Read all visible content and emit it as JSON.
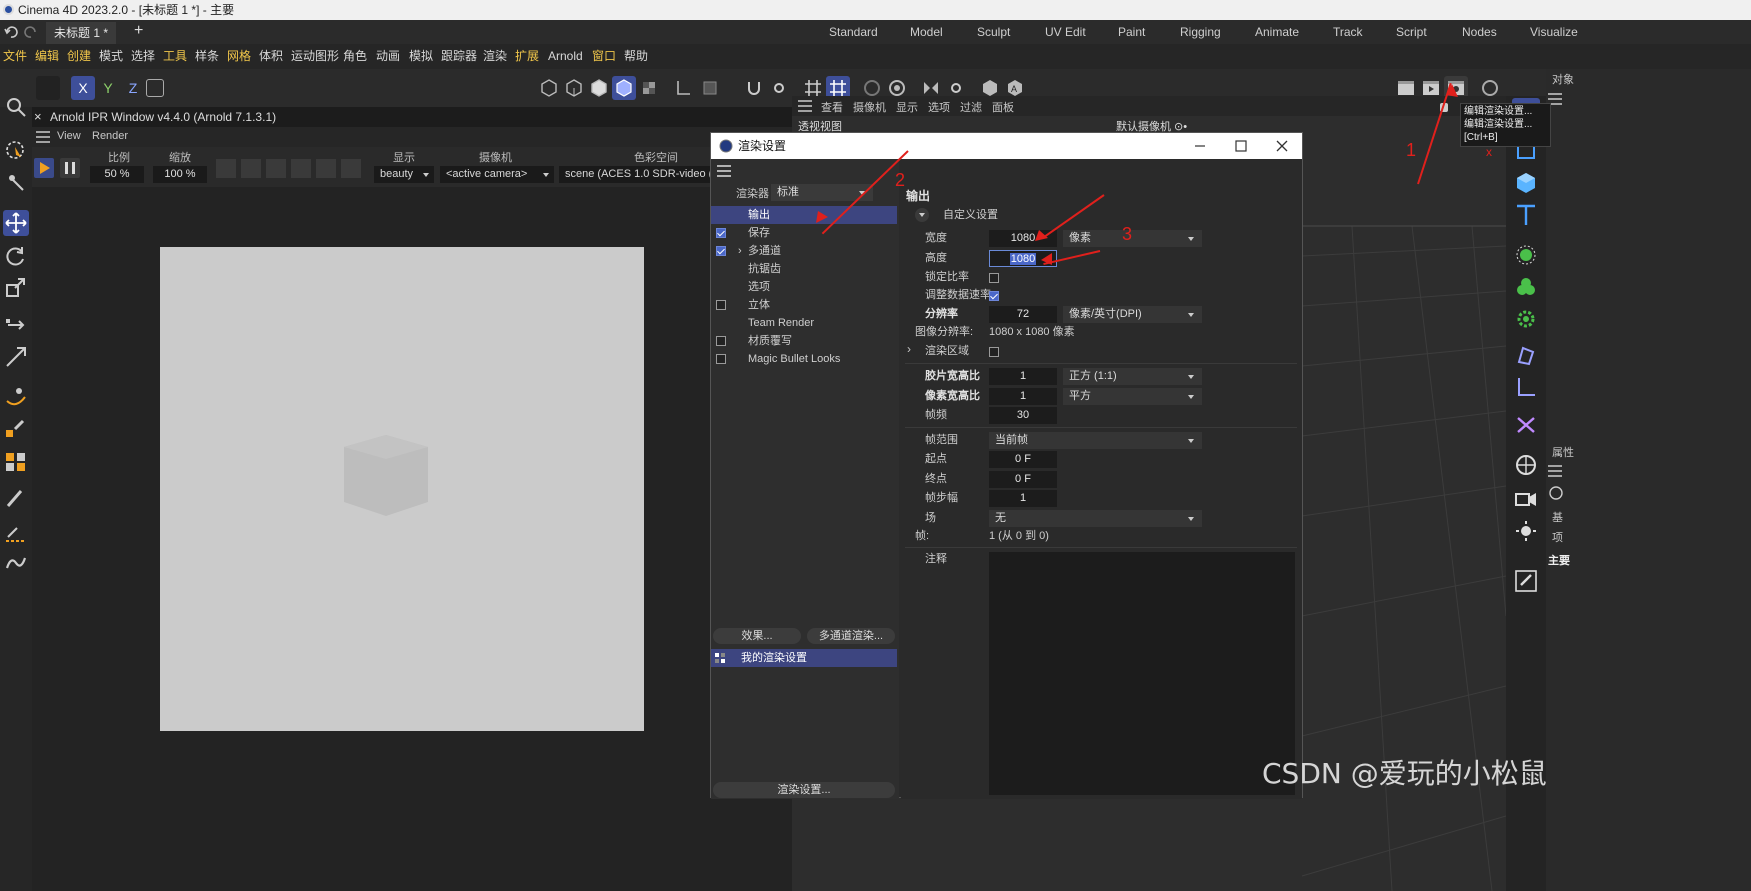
{
  "app": {
    "title": "Cinema 4D 2023.2.0 - [未标题 1 *] - 主要"
  },
  "layout_bar": {
    "doc_tab": "未标题 1 *",
    "add_symbol": "+",
    "tabs": [
      "Standard",
      "Model",
      "Sculpt",
      "UV Edit",
      "Paint",
      "Rigging",
      "Animate",
      "Track",
      "Script",
      "Nodes",
      "Visualize"
    ]
  },
  "menubar": [
    "文件",
    "编辑",
    "创建",
    "模式",
    "选择",
    "工具",
    "样条",
    "网格",
    "体积",
    "运动图形",
    "角色",
    "动画",
    "模拟",
    "跟踪器",
    "渲染",
    "扩展",
    "Arnold",
    "窗口",
    "帮助"
  ],
  "axis": {
    "x": "X",
    "y": "Y",
    "z": "Z"
  },
  "arnold": {
    "title": "Arnold IPR Window v4.4.0 (Arnold 7.1.3.1)",
    "close": "×",
    "menu": [
      "View",
      "Render"
    ],
    "scale_label": "比例",
    "scale_value": "50 %",
    "zoom_label": "缩放",
    "zoom_value": "100 %",
    "display_label": "显示",
    "display_value": "beauty",
    "camera_label": "摄像机",
    "camera_value": "<active camera>",
    "colorspace_label": "色彩空间",
    "colorspace_value": "scene (ACES 1.0 SDR-video (sR"
  },
  "viewport": {
    "menu": [
      "查看",
      "摄像机",
      "显示",
      "选项",
      "过滤",
      "面板"
    ],
    "label": "透视视图",
    "camera": "默认摄像机 ⊙•"
  },
  "tooltip": {
    "line1": "编辑渲染设置...",
    "line2": "编辑渲染设置...",
    "line3": "[Ctrl+B]"
  },
  "far_right": {
    "top": "对象",
    "mid": "属性",
    "bottom": "主要",
    "tab_ji": "基",
    "tab_xiang": "项"
  },
  "dialog": {
    "title": "渲染设置",
    "renderer_label": "渲染器",
    "renderer_value": "标准",
    "tree": [
      {
        "label": "输出",
        "checked": null,
        "selected": true
      },
      {
        "label": "保存",
        "checked": true
      },
      {
        "label": "多通道",
        "checked": true,
        "expand": true
      },
      {
        "label": "抗锯齿",
        "checked": null
      },
      {
        "label": "选项",
        "checked": null
      },
      {
        "label": "立体",
        "checked": false
      },
      {
        "label": "Team Render",
        "checked": null
      },
      {
        "label": "材质覆写",
        "checked": false
      },
      {
        "label": "Magic Bullet Looks",
        "checked": false
      }
    ],
    "effects_button": "效果...",
    "multipass_button": "多通道渲染...",
    "preset": "我的渲染设置",
    "render_settings_button": "渲染设置...",
    "section_title": "输出",
    "custom_settings": "自定义设置",
    "width_label": "宽度",
    "width_value": "1080",
    "width_unit": "像素",
    "height_label": "高度",
    "height_value": "1080",
    "lock_ratio_label": "锁定比率",
    "adapt_rate_label": "调整数据速率",
    "resolution_label": "分辨率",
    "resolution_value": "72",
    "resolution_unit": "像素/英寸(DPI)",
    "image_res_label": "图像分辨率:",
    "image_res_value": "1080 x 1080 像素",
    "render_region_label": "渲染区域",
    "film_ratio_label": "胶片宽高比",
    "film_ratio_value": "1",
    "film_ratio_preset": "正方 (1:1)",
    "pixel_ratio_label": "像素宽高比",
    "pixel_ratio_value": "1",
    "pixel_ratio_preset": "平方",
    "fps_label": "帧频",
    "fps_value": "30",
    "frame_range_label": "帧范围",
    "frame_range_value": "当前帧",
    "start_label": "起点",
    "start_value": "0 F",
    "end_label": "终点",
    "end_value": "0 F",
    "step_label": "帧步幅",
    "step_value": "1",
    "field_label": "场",
    "field_value": "无",
    "frames_label": "帧:",
    "frames_value": "1 (从 0 到 0)",
    "notes_label": "注释"
  },
  "annotations": {
    "n1": "1",
    "n2": "2",
    "n3": "3",
    "x": "x"
  },
  "watermark": "CSDN @爱玩的小松鼠",
  "colors": {
    "accent": "#3e4f9a",
    "selection": "#3d4580",
    "annotation": "#e0201c",
    "menu_highlight": "#f0c64a"
  }
}
